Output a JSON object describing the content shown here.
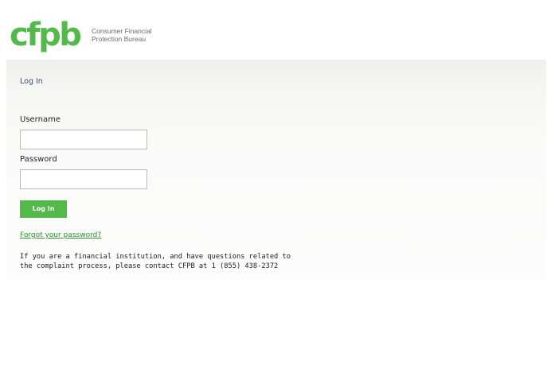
{
  "colors": {
    "brand_green": "#53b94a",
    "link_green": "#2e8f2e",
    "logo_subtext": "#6b6b6b",
    "panel_background": "#f6f6f5"
  },
  "header": {
    "logo_text": "cfpb",
    "org_name_line1": "Consumer Financial",
    "org_name_line2": "Protection Bureau"
  },
  "main": {
    "title": "Log In",
    "username_label": "Username",
    "username_value": "",
    "password_label": "Password",
    "password_value": "",
    "login_button_label": "Log In",
    "forgot_password_link": "Forgot your password?",
    "contact_line1": "If you are a financial institution, and have questions related to",
    "contact_line2": "the complaint process, please contact CFPB at 1 (855) 438-2372"
  }
}
